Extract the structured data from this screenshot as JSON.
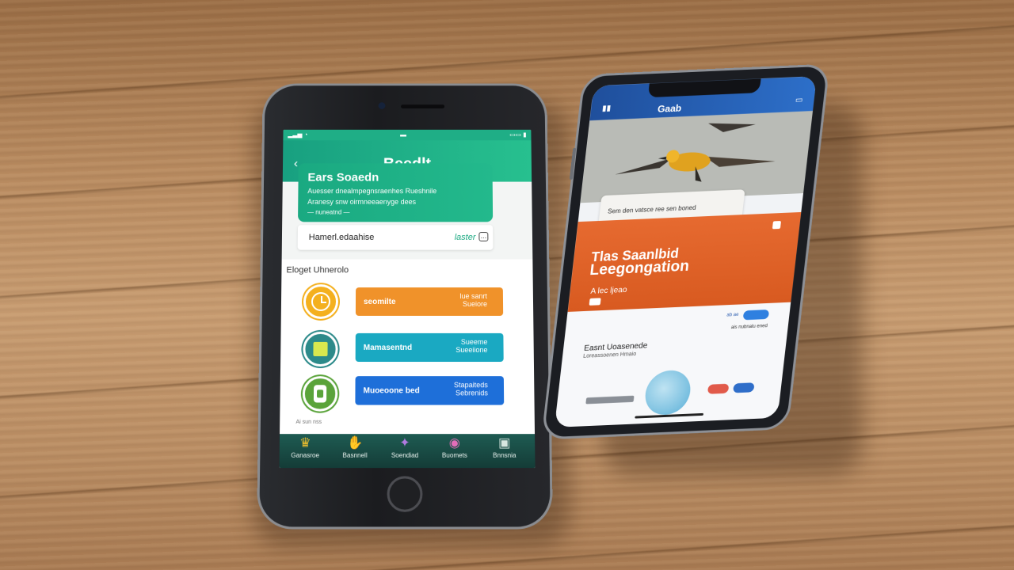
{
  "scene": {
    "description_colors": {
      "wood": "#b88a5f",
      "accent_green": "#1fae86",
      "accent_orange": "#e66a30"
    }
  },
  "phone_left": {
    "app_title": "Beedlt",
    "card": {
      "title": "Ears Soaedn",
      "line1": "Auesser dnealmpegnsraenhes Rueshnile",
      "line2": "Aranesy snw oirmneeaenyge dees",
      "line3": "— nuneatnd —"
    },
    "row": {
      "text": "Hamerl.edaahise",
      "link": "laster"
    },
    "section_title": "Eloget Uhnerolo",
    "items": [
      {
        "label": "seomilte",
        "aux": "lue sanrt Sueiore",
        "color": "#f0922a",
        "icon": "clock-icon",
        "icon_color": "#f4b01e"
      },
      {
        "label": "Mamasentnd",
        "aux": "Sueeme Sueeiione",
        "color": "#1aa9c2",
        "icon": "tablet-icon",
        "icon_color": "#2c8a8a"
      },
      {
        "label": "Muoeoone bed",
        "aux": "Stapaiteds Sebrenids",
        "color": "#1e6fd9",
        "icon": "backpack-icon",
        "icon_color": "#5aa33a"
      }
    ],
    "footnote": "Ai sun nss",
    "tabs": [
      {
        "icon": "crown-icon",
        "label": "Ganasroe"
      },
      {
        "icon": "handshake-icon",
        "label": "Basnnell"
      },
      {
        "icon": "star-icon",
        "label": "Soendiad"
      },
      {
        "icon": "globe-icon",
        "label": "Buomets"
      },
      {
        "icon": "bag-icon",
        "label": "Bnnsnia"
      }
    ]
  },
  "phone_right": {
    "header_title": "Gaab",
    "caption": "Sem den vatsce   ree sen boned",
    "orange_line1": "Tlas Saanlbid",
    "orange_line2": "Leegongation",
    "orange_line3": "A  lec ljeao",
    "sheet_small": "ab ae",
    "sheet_small2": "ais nubnalu ened",
    "section_title": "Easnt Uoasenede",
    "section_sub": "Loreassoenen Hmaio"
  }
}
